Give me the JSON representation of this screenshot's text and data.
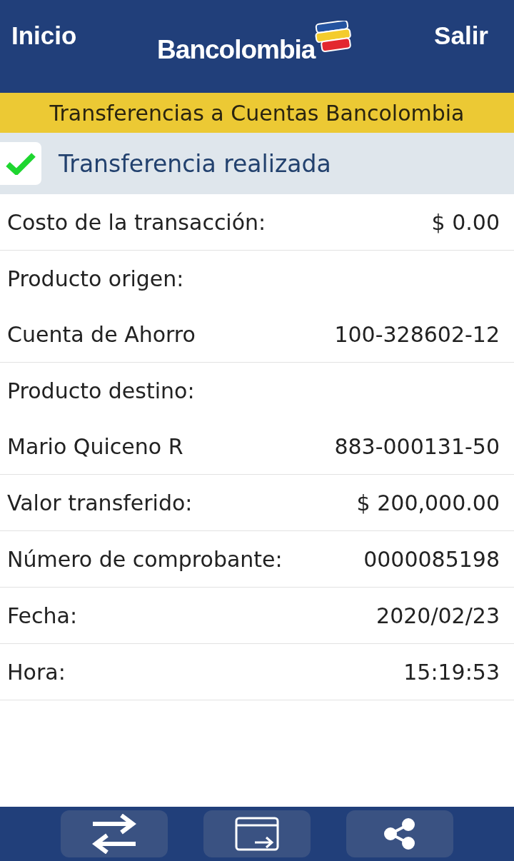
{
  "header": {
    "left_link": "Inicio",
    "logo": "Bancolombia",
    "right_link": "Salir"
  },
  "title": "Transferencias a Cuentas Bancolombia",
  "status": {
    "text": "Transferencia realizada",
    "success": true
  },
  "sections": [
    {
      "rows": [
        {
          "label": "Costo de la transacción:",
          "value": "$ 0.00"
        }
      ]
    },
    {
      "rows": [
        {
          "label": "Producto origen:"
        },
        {
          "label": "Cuenta de Ahorro",
          "value": "100-328602-12"
        }
      ]
    },
    {
      "rows": [
        {
          "label": "Producto destino:"
        },
        {
          "label": "Mario Quiceno R",
          "value": "883-000131-50"
        }
      ]
    },
    {
      "rows": [
        {
          "label": "Valor transferido:",
          "value": "$ 200,000.00"
        }
      ]
    },
    {
      "rows": [
        {
          "label": "Número de comprobante:",
          "value": "0000085198"
        }
      ]
    },
    {
      "rows": [
        {
          "label": "Fecha:",
          "value": "2020/02/23"
        }
      ]
    },
    {
      "rows": [
        {
          "label": "Hora:",
          "value": "15:19:53"
        }
      ]
    }
  ],
  "bottom_bar": [
    {
      "kind": "transfer"
    },
    {
      "kind": "card"
    },
    {
      "kind": "share"
    }
  ]
}
